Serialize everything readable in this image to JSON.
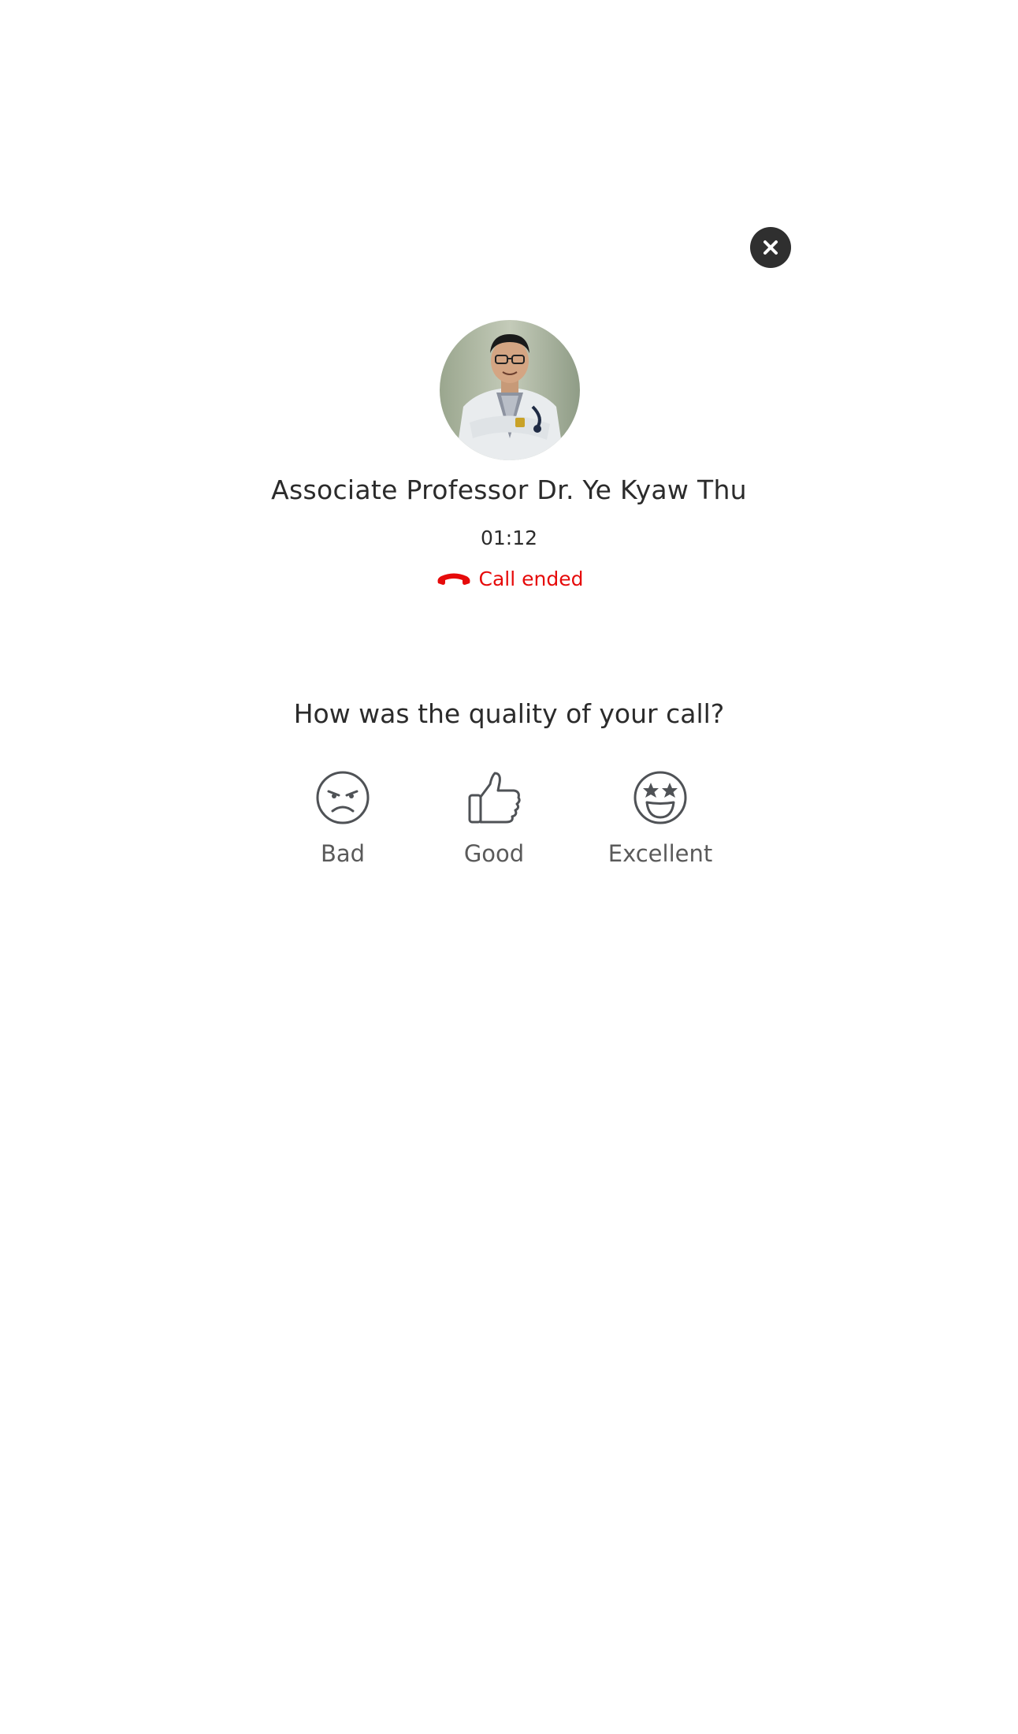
{
  "dialog": {
    "close_icon": "close-icon"
  },
  "call": {
    "doctor_name": "Associate Professor Dr. Ye Kyaw Thu",
    "duration": "01:12",
    "status": "Call ended",
    "status_icon": "phone-hangup-icon",
    "status_color": "#e60a0a"
  },
  "feedback": {
    "question": "How was the quality of your call?",
    "options": [
      {
        "label": "Bad",
        "icon": "angry-face-icon"
      },
      {
        "label": "Good",
        "icon": "thumbs-up-icon"
      },
      {
        "label": "Excellent",
        "icon": "star-eyes-face-icon"
      }
    ]
  },
  "colors": {
    "close_button_bg": "#2f2f2f",
    "icon_stroke": "#4f5256"
  }
}
